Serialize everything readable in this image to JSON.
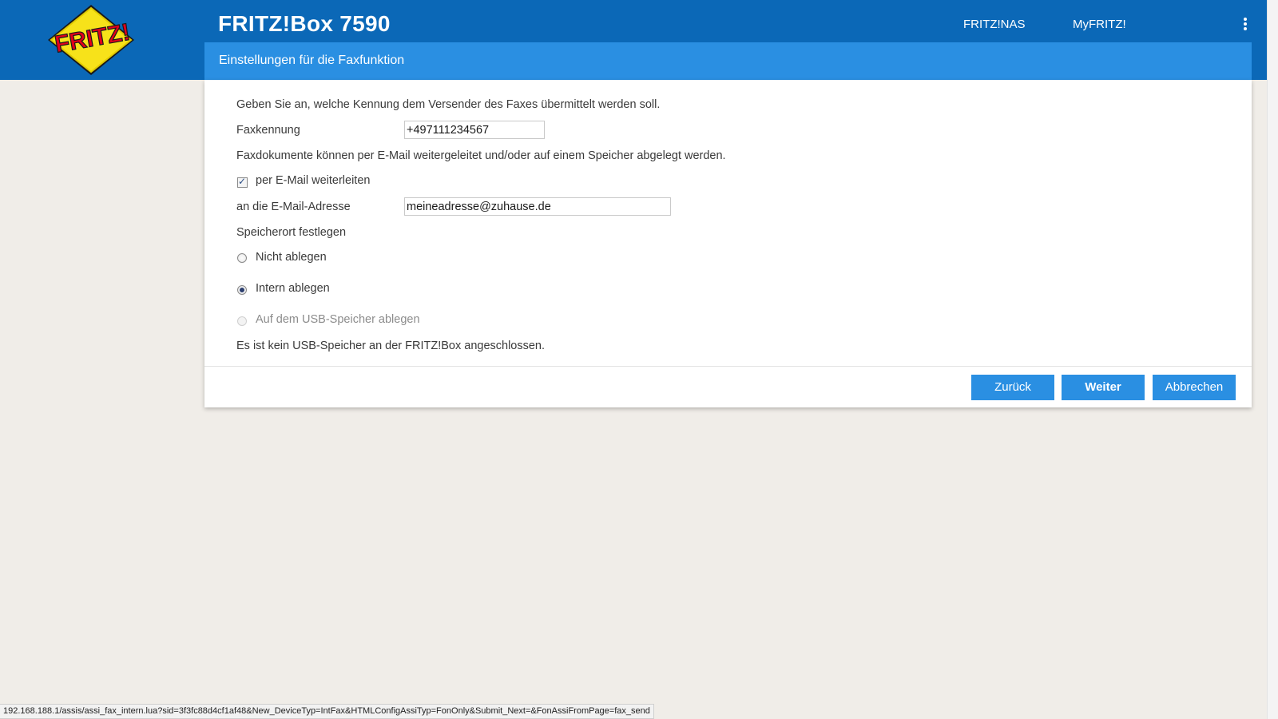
{
  "header": {
    "brand_colors": {
      "header_bg": "#0b68b7",
      "subheader_bg": "#2a8fe2",
      "button_bg": "#2a8fe2",
      "page_bg": "#f0ede8"
    },
    "logo_icon": "fritz-logo",
    "product_title": "FRITZ!Box 7590",
    "nav_links": {
      "nas": "FRITZ!NAS",
      "myfritz": "MyFRITZ!"
    },
    "menu_icon": "kebab-menu-icon"
  },
  "page": {
    "subtitle": "Einstellungen für die Faxfunktion"
  },
  "form": {
    "intro_text": "Geben Sie an, welche Kennung dem Versender des Faxes übermittelt werden soll.",
    "fax_id_label": "Faxkennung",
    "fax_id_value": "+497111234567",
    "forward_info": "Faxdokumente können per E-Mail weitergeleitet und/oder auf einem Speicher abgelegt werden.",
    "email_forward_label": "per E-Mail weiterleiten",
    "email_forward_checked": true,
    "email_label": "an die E-Mail-Adresse",
    "email_value": "meineadresse@zuhause.de",
    "storage_heading": "Speicherort festlegen",
    "storage_options": [
      {
        "label": "Nicht ablegen",
        "checked": false,
        "disabled": false
      },
      {
        "label": "Intern ablegen",
        "checked": true,
        "disabled": false
      },
      {
        "label": "Auf dem USB-Speicher ablegen",
        "checked": false,
        "disabled": true
      }
    ],
    "usb_notice": "Es ist kein USB-Speicher an der FRITZ!Box angeschlossen."
  },
  "buttons": {
    "back": "Zurück",
    "next": "Weiter",
    "cancel": "Abbrechen"
  },
  "statusbar": {
    "url": "192.168.188.1/assis/assi_fax_intern.lua?sid=3f3fc88d4cf1af48&New_DeviceTyp=IntFax&HTMLConfigAssiTyp=FonOnly&Submit_Next=&FonAssiFromPage=fax_send"
  }
}
